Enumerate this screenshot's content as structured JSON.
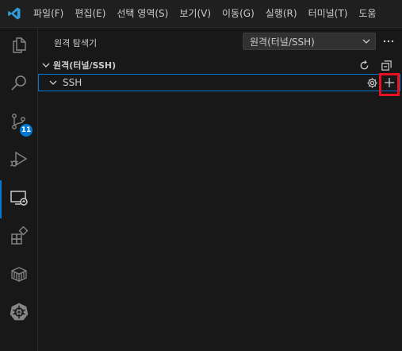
{
  "menubar": {
    "app_icon": "vscode-logo-icon",
    "items": [
      "파일(F)",
      "편집(E)",
      "선택 영역(S)",
      "보기(V)",
      "이동(G)",
      "실행(R)",
      "터미널(T)",
      "도움"
    ]
  },
  "activitybar": {
    "items": [
      {
        "name": "explorer",
        "icon": "files-icon"
      },
      {
        "name": "search",
        "icon": "search-icon"
      },
      {
        "name": "source-control",
        "icon": "source-control-icon",
        "badge": "11"
      },
      {
        "name": "run-debug",
        "icon": "run-debug-icon"
      },
      {
        "name": "remote-explorer",
        "icon": "remote-explorer-icon",
        "active": true
      },
      {
        "name": "extensions",
        "icon": "extensions-icon"
      },
      {
        "name": "containers",
        "icon": "box-icon"
      },
      {
        "name": "kubernetes",
        "icon": "kubernetes-icon"
      }
    ]
  },
  "panel": {
    "title": "원격 탐색기",
    "select_value": "원격(터널/SSH)",
    "section_title": "원격(터널/SSH)",
    "tree_item": "SSH"
  },
  "colors": {
    "accent": "#0078d4",
    "highlight": "#e81123",
    "background": "#181818"
  }
}
